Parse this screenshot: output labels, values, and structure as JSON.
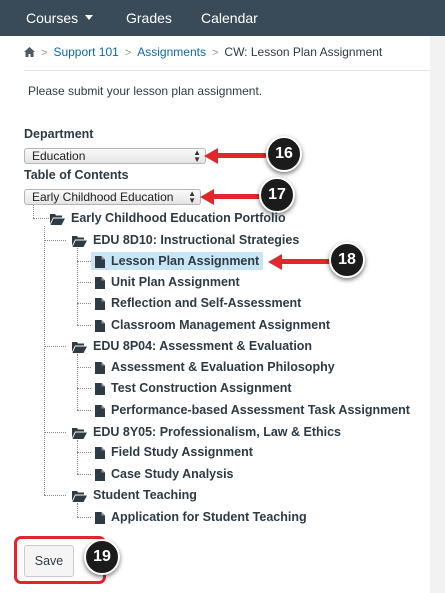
{
  "nav": {
    "items": [
      {
        "label": "Courses",
        "has_dropdown": true
      },
      {
        "label": "Grades"
      },
      {
        "label": "Calendar"
      }
    ],
    "background": "#394b58"
  },
  "breadcrumb": {
    "home_icon": "home-icon",
    "items": [
      "Support 101",
      "Assignments",
      "CW: Lesson Plan Assignment"
    ],
    "separator": ">"
  },
  "instructions": "Please submit your lesson plan assignment.",
  "department": {
    "label": "Department",
    "selected": "Education"
  },
  "toc": {
    "label": "Table of Contents",
    "selected": "Early Childhood Education"
  },
  "tree": {
    "root": "Early Childhood Education Portfolio",
    "folders": [
      {
        "name": "EDU 8D10: Instructional Strategies",
        "files": [
          "Lesson Plan Assignment",
          "Unit Plan Assignment",
          "Reflection and Self-Assessment",
          "Classroom Management Assignment"
        ]
      },
      {
        "name": "EDU 8P04: Assessment & Evaluation",
        "files": [
          "Assessment & Evaluation Philosophy",
          "Test Construction Assignment",
          "Performance-based Assessment Task Assignment"
        ]
      },
      {
        "name": "EDU 8Y05: Professionalism, Law & Ethics",
        "files": [
          "Field Study Assignment",
          "Case Study Analysis"
        ]
      },
      {
        "name": "Student Teaching",
        "files": [
          "Application for Student Teaching"
        ]
      }
    ],
    "selected_file": "Lesson Plan Assignment",
    "selected_color": "#c9e5f5"
  },
  "annotations": {
    "steps": [
      "16",
      "17",
      "18",
      "19"
    ],
    "accent": "#e3262c"
  },
  "save_label": "Save"
}
